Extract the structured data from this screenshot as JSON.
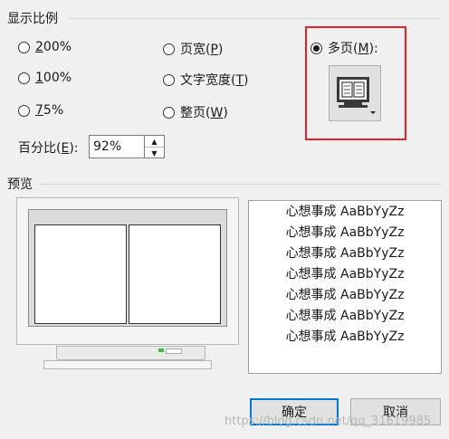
{
  "zoom_group": {
    "title": "显示比例"
  },
  "radios": {
    "r200": {
      "label": "200%",
      "mnemonic": "2",
      "rest": "00%"
    },
    "r100": {
      "label": "100%",
      "mnemonic": "1",
      "rest": "00%"
    },
    "r75": {
      "label": "75%",
      "mnemonic": "7",
      "rest": "5%"
    },
    "page_width": {
      "prefix": "页宽(",
      "mnemonic": "P",
      "suffix": ")"
    },
    "text_width": {
      "prefix": "文字宽度(",
      "mnemonic": "T",
      "suffix": ")"
    },
    "whole_page": {
      "prefix": "整页(",
      "mnemonic": "W",
      "suffix": ")"
    },
    "many_pages": {
      "prefix": "多页(",
      "mnemonic": "M",
      "suffix": "):"
    }
  },
  "percent": {
    "prefix": "百分比(",
    "mnemonic": "E",
    "suffix": "):",
    "value": "92%"
  },
  "preview_group": {
    "title": "预览"
  },
  "sample_lines": [
    "心想事成  AaBbYyZz",
    "心想事成  AaBbYyZz",
    "心想事成  AaBbYyZz",
    "心想事成  AaBbYyZz",
    "心想事成  AaBbYyZz",
    "心想事成  AaBbYyZz",
    "心想事成  AaBbYyZz"
  ],
  "buttons": {
    "ok": "确定",
    "cancel": "取消"
  },
  "watermark": "https://blog.csdn.net/qq_31619985",
  "colors": {
    "highlight": "#e8202a",
    "focus": "#0078d7"
  }
}
